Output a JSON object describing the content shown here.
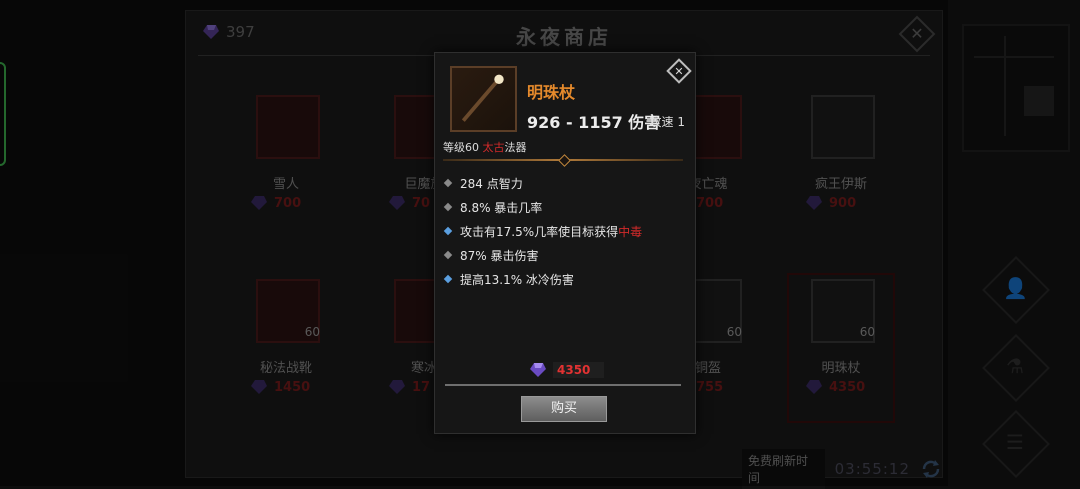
{
  "shop": {
    "title": "永夜商店",
    "currency_amount": "397",
    "refresh_label": "免费刷新时间",
    "refresh_time": "03:55:12",
    "items": [
      {
        "name": "雪人",
        "price": "700",
        "level": ""
      },
      {
        "name": "巨魔施",
        "price": "70",
        "level": ""
      },
      {
        "name": "夜亡魂",
        "price": "700",
        "level": ""
      },
      {
        "name": "疯王伊斯",
        "price": "900",
        "level": ""
      },
      {
        "name": "秘法战靴",
        "price": "1450",
        "level": "60"
      },
      {
        "name": "寒冰",
        "price": "17",
        "level": ""
      },
      {
        "name": "铜盔",
        "price": "755",
        "level": "60"
      },
      {
        "name": "明珠杖",
        "price": "4350",
        "level": "60"
      }
    ]
  },
  "tooltip": {
    "name": "明珠杖",
    "damage": "926 - 1157 伤害",
    "attack_speed": "攻速 1",
    "level_prefix": "等级60 ",
    "rarity": "太古",
    "type": "法器",
    "stats": [
      {
        "text": "284 点智力"
      },
      {
        "text": "8.8% 暴击几率"
      },
      {
        "text_before": "攻击有17.5%几率使目标获得",
        "highlight": "中毒"
      },
      {
        "text": "87% 暴击伤害"
      },
      {
        "text": "提高13.1% 冰冷伤害"
      }
    ],
    "price": "4350",
    "buy_label": "购买"
  },
  "colors": {
    "gem": "#7b5bd6",
    "rarity_red": "#d12a2a",
    "item_name_orange": "#e58a2c"
  }
}
